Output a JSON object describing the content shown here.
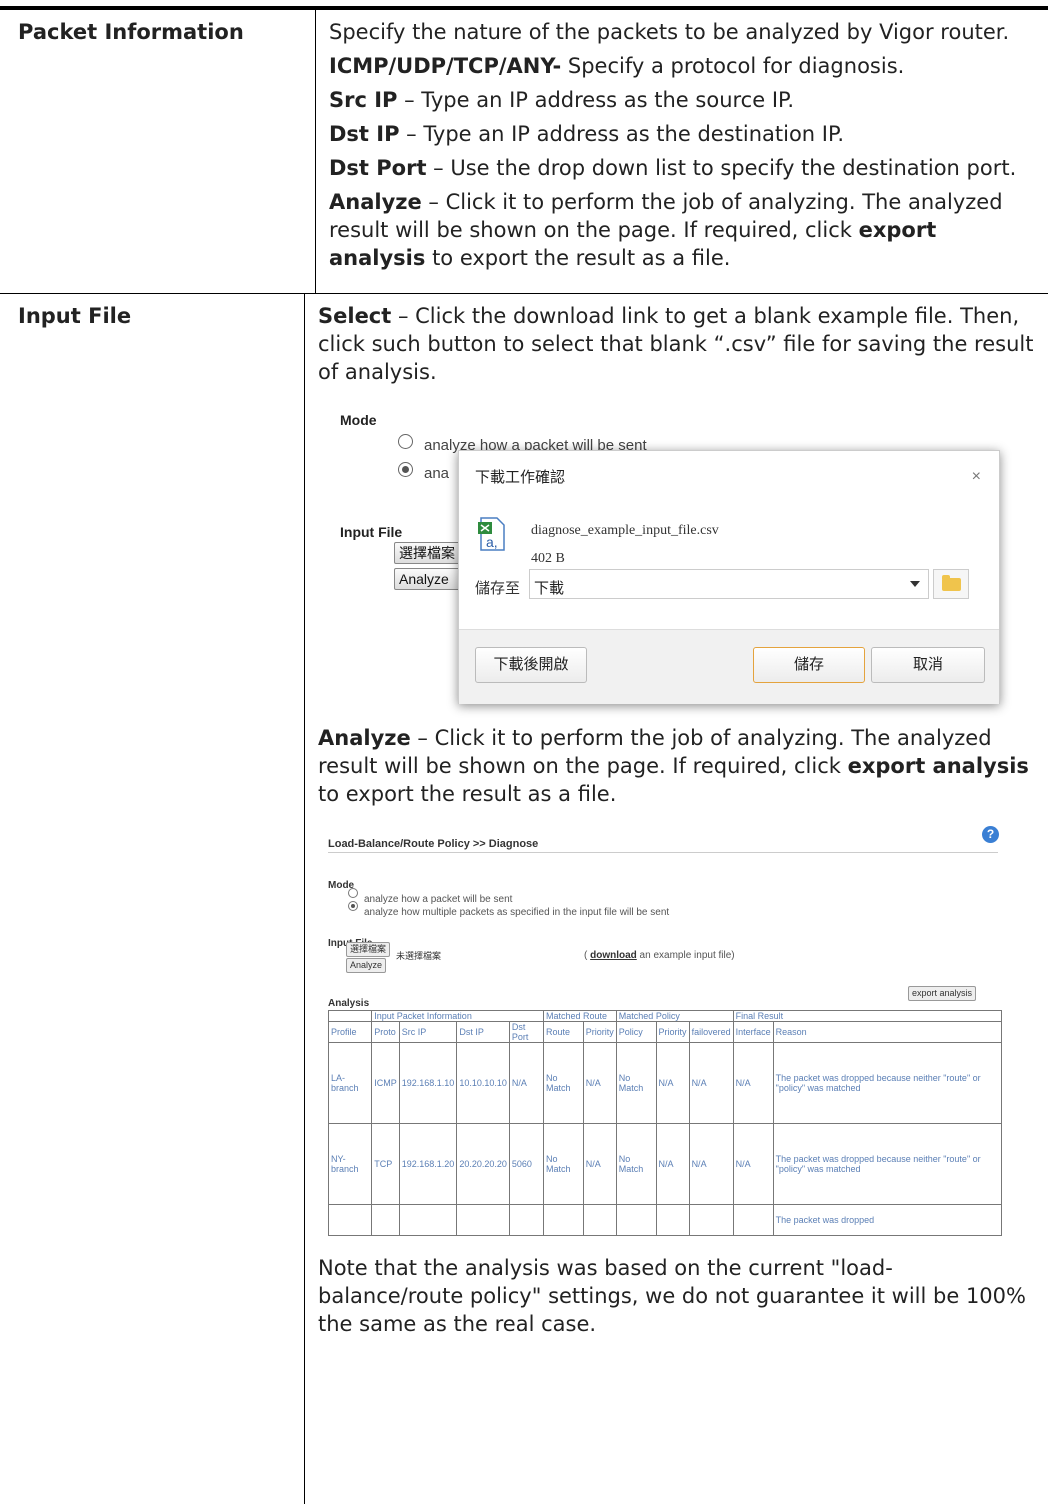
{
  "row1": {
    "label": "Packet Information",
    "p1": "Specify the nature of the packets to be analyzed by Vigor router.",
    "p2_term": "ICMP/UDP/TCP/ANY-",
    "p2_text": " Specify a protocol for diagnosis.",
    "p3_term": "Src IP",
    "p3_text": " – Type an IP address as the source IP.",
    "p4_term": "Dst IP",
    "p4_text": " – Type an IP address as the destination IP.",
    "p5_term": "Dst Port",
    "p5_text": " – Use the drop down list to specify the destination port.",
    "p6_term": "Analyze",
    "p6_text": " – Click it to perform the job of analyzing. The analyzed result will be shown on the page. If required, click ",
    "p6_term2": "export analysis",
    "p6_text2": " to export the result as a file."
  },
  "row2": {
    "label": "Input File",
    "p1_term": "Select",
    "p1_text": " – Click the download link to get a blank example file. Then, click such button to select that blank “.csv” file for saving the result of analysis.",
    "p2_term": "Analyze",
    "p2_text": " – Click it to perform the job of analyzing. The analyzed result will be shown on the page. If required, click ",
    "p2_term2": "export analysis",
    "p2_text2": " to export the result as a file.",
    "note": "Note that the analysis was based on the current \"load-balance/route policy\" settings, we do not guarantee it will be 100% the same as the real case."
  },
  "fig1": {
    "mode": "Mode",
    "opt1": "analyze how a packet will be sent",
    "opt2": "ana",
    "input_file": "Input File",
    "choose_btn": "選擇檔案",
    "analyze_btn": "Analyze",
    "dialog": {
      "title": "下載工作確認",
      "close": "×",
      "filename": "diagnose_example_input_file.csv",
      "size": "402 B",
      "save_to_label": "儲存至",
      "save_to_value": "下載",
      "open_after": "下載後開啟",
      "save": "儲存",
      "cancel": "取消"
    }
  },
  "fig2": {
    "header": "Load-Balance/Route Policy >> Diagnose",
    "help": "?",
    "mode": "Mode",
    "opt1": "analyze how a packet will be sent",
    "opt2": "analyze how multiple packets as specified in the input file will be sent",
    "input_file": "Input File",
    "choose_btn": "選擇檔案",
    "no_file": "未選擇檔案",
    "dl_open": "( ",
    "dl_link": "download",
    "dl_rest": " an example input file)",
    "analyze_btn": "Analyze",
    "analysis": "Analysis",
    "export_btn": "export analysis",
    "groups": [
      "Input Packet Information",
      "Matched Route",
      "Matched Policy",
      "Final Result"
    ],
    "columns": [
      "Profile",
      "Proto",
      "Src IP",
      "Dst IP",
      "Dst Port",
      "Route",
      "Priority",
      "Policy",
      "Priority",
      "failovered",
      "Interface",
      "Reason"
    ],
    "rows": [
      [
        "LA-branch",
        "ICMP",
        "192.168.1.10",
        "10.10.10.10",
        "N/A",
        "No Match",
        "N/A",
        "No Match",
        "N/A",
        "N/A",
        "N/A",
        "The packet was dropped because neither \"route\" or \"policy\" was matched"
      ],
      [
        "NY-branch",
        "TCP",
        "192.168.1.20",
        "20.20.20.20",
        "5060",
        "No Match",
        "N/A",
        "No Match",
        "N/A",
        "N/A",
        "N/A",
        "The packet was dropped because neither \"route\" or \"policy\" was matched"
      ],
      [
        "",
        "",
        "",
        "",
        "",
        "",
        "",
        "",
        "",
        "",
        "",
        "The packet was dropped"
      ]
    ]
  },
  "colors": {
    "table_text": "#5b7fb5",
    "save_border": "#e4a33d",
    "help_icon": "#3a7fd4",
    "folder": "#f0c44c"
  }
}
